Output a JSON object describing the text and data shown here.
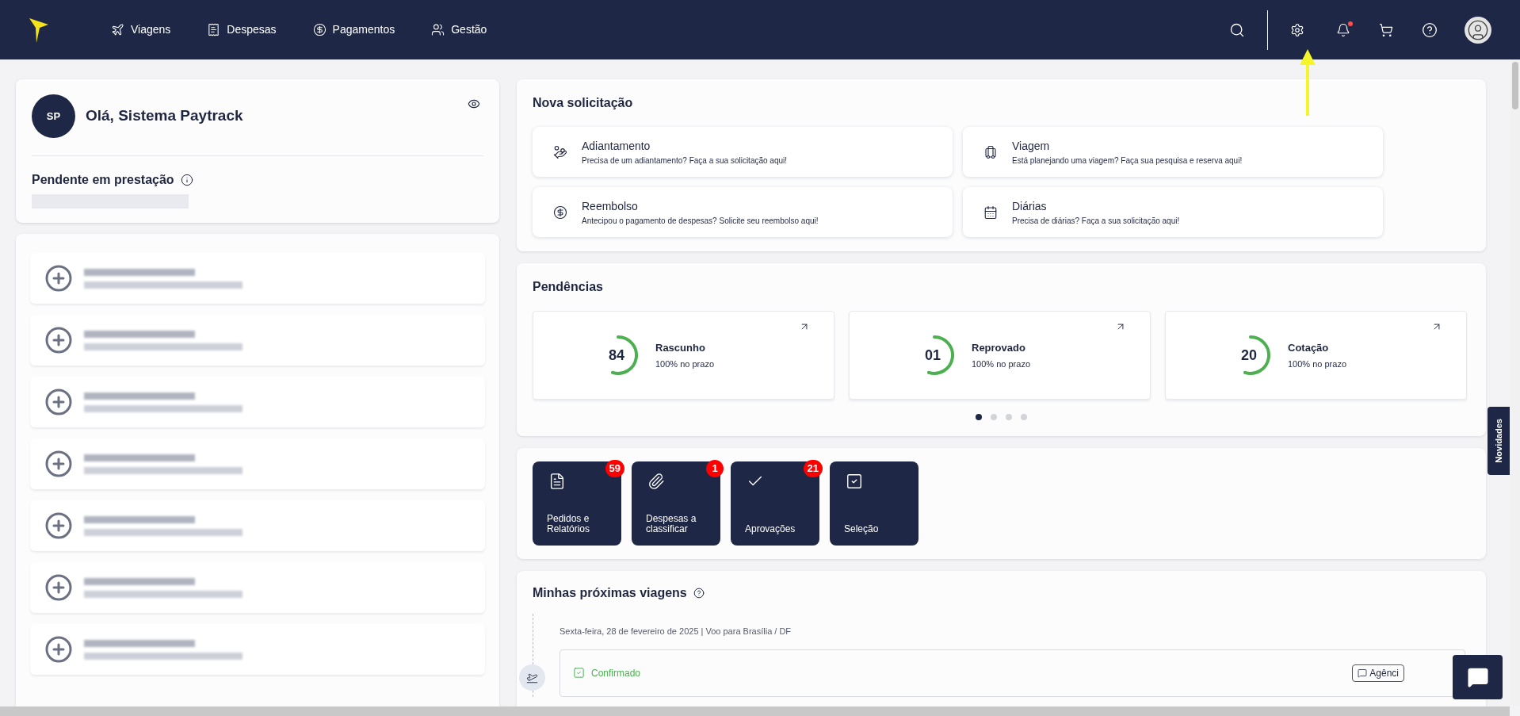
{
  "nav": {
    "items": [
      {
        "label": "Viagens"
      },
      {
        "label": "Despesas"
      },
      {
        "label": "Pagamentos"
      },
      {
        "label": "Gestão"
      }
    ],
    "notification_dot": true
  },
  "profile": {
    "initials": "SP",
    "greeting": "Olá, Sistema Paytrack",
    "pending_title": "Pendente em prestação"
  },
  "shortcuts": [
    {
      "kind": "blurred"
    },
    {
      "kind": "blurred"
    },
    {
      "kind": "blurred"
    },
    {
      "kind": "blurred"
    },
    {
      "kind": "blurred"
    },
    {
      "kind": "blurred"
    },
    {
      "kind": "blurred"
    }
  ],
  "new_request": {
    "title": "Nova solicitação",
    "options": [
      {
        "title": "Adiantamento",
        "description": "Precisa de um adiantamento? Faça a sua solicitação aqui!"
      },
      {
        "title": "Viagem",
        "description": "Está planejando uma viagem? Faça sua pesquisa e reserva aqui!"
      },
      {
        "title": "Reembolso",
        "description": "Antecipou o pagamento de despesas? Solicite seu reembolso aqui!"
      },
      {
        "title": "Diárias",
        "description": "Precisa de diárias? Faça a sua solicitação aqui!"
      }
    ]
  },
  "pending": {
    "title": "Pendências",
    "cards": [
      {
        "count": "84",
        "label": "Rascunho",
        "note": "100% no prazo"
      },
      {
        "count": "01",
        "label": "Reprovado",
        "note": "100% no prazo"
      },
      {
        "count": "20",
        "label": "Cotação",
        "note": "100% no prazo"
      }
    ],
    "dots": [
      {
        "selected": true
      },
      {
        "selected": false
      },
      {
        "selected": false
      },
      {
        "selected": false
      }
    ]
  },
  "tiles": [
    {
      "label": "Pedidos e Relatórios",
      "badge": "59"
    },
    {
      "label": "Despesas a classificar",
      "badge": "1"
    },
    {
      "label": "Aprovações",
      "badge": "21"
    },
    {
      "label": "Seleção"
    }
  ],
  "trips": {
    "title": "Minhas próximas viagens",
    "entries": [
      {
        "heading": "Sexta-feira, 28 de fevereiro de 2025 | Voo para Brasília / DF",
        "status": "Confirmado",
        "agency_button": "Agênci"
      }
    ]
  },
  "side_tab": "Novidades"
}
